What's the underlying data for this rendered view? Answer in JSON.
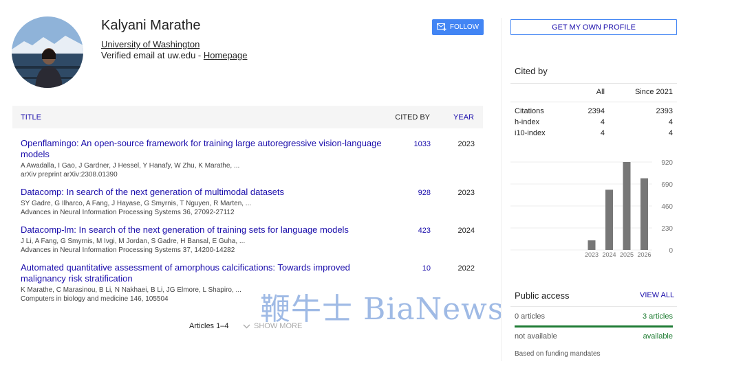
{
  "profile": {
    "name": "Kalyani Marathe",
    "affiliation": "University of Washington",
    "email_text": "Verified email at uw.edu - ",
    "homepage_label": "Homepage",
    "follow_label": "FOLLOW"
  },
  "table": {
    "col_title": "TITLE",
    "col_cited": "CITED BY",
    "col_year": "YEAR",
    "articles": [
      {
        "title": "Openflamingo: An open-source framework for training large autoregressive vision-language models",
        "authors": "A Awadalla, I Gao, J Gardner, J Hessel, Y Hanafy, W Zhu, K Marathe, ...",
        "venue": "arXiv preprint arXiv:2308.01390",
        "cited": "1033",
        "year": "2023"
      },
      {
        "title": "Datacomp: In search of the next generation of multimodal datasets",
        "authors": "SY Gadre, G Ilharco, A Fang, J Hayase, G Smyrnis, T Nguyen, R Marten, ...",
        "venue": "Advances in Neural Information Processing Systems 36, 27092-27112",
        "cited": "928",
        "year": "2023"
      },
      {
        "title": "Datacomp-lm: In search of the next generation of training sets for language models",
        "authors": "J Li, A Fang, G Smyrnis, M Ivgi, M Jordan, S Gadre, H Bansal, E Guha, ...",
        "venue": "Advances in Neural Information Processing Systems 37, 14200-14282",
        "cited": "423",
        "year": "2024"
      },
      {
        "title": "Automated quantitative assessment of amorphous calcifications: Towards improved malignancy risk stratification",
        "authors": "K Marathe, C Marasinou, B Li, N Nakhaei, B Li, JG Elmore, L Shapiro, ...",
        "venue": "Computers in biology and medicine 146, 105504",
        "cited": "10",
        "year": "2022"
      }
    ],
    "pager": "Articles 1–4",
    "show_more": "SHOW MORE"
  },
  "watermark": "鞭牛士 BiaNews",
  "sidebar": {
    "own_profile_label": "GET MY OWN PROFILE",
    "cited_by_label": "Cited by",
    "col_all": "All",
    "col_since": "Since 2021",
    "metrics": [
      {
        "label": "Citations",
        "all": "2394",
        "since": "2393"
      },
      {
        "label": "h-index",
        "all": "4",
        "since": "4"
      },
      {
        "label": "i10-index",
        "all": "4",
        "since": "4"
      }
    ],
    "public_access": {
      "label": "Public access",
      "view_all": "VIEW ALL",
      "left1": "0 articles",
      "right1": "3 articles",
      "left2": "not available",
      "right2": "available",
      "note": "Based on funding mandates",
      "available_fraction": 1.0
    }
  },
  "chart_data": {
    "type": "bar",
    "categories": [
      "2023",
      "2024",
      "2025",
      "2026"
    ],
    "values": [
      100,
      630,
      920,
      750
    ],
    "yticks": [
      0,
      230,
      460,
      690,
      920
    ],
    "ylim": [
      0,
      920
    ],
    "grid": true,
    "bar_color": "#777777"
  },
  "colors": {
    "link": "#1a0dab",
    "accent": "#4285f4",
    "public_access_green": "#1e7b34"
  }
}
